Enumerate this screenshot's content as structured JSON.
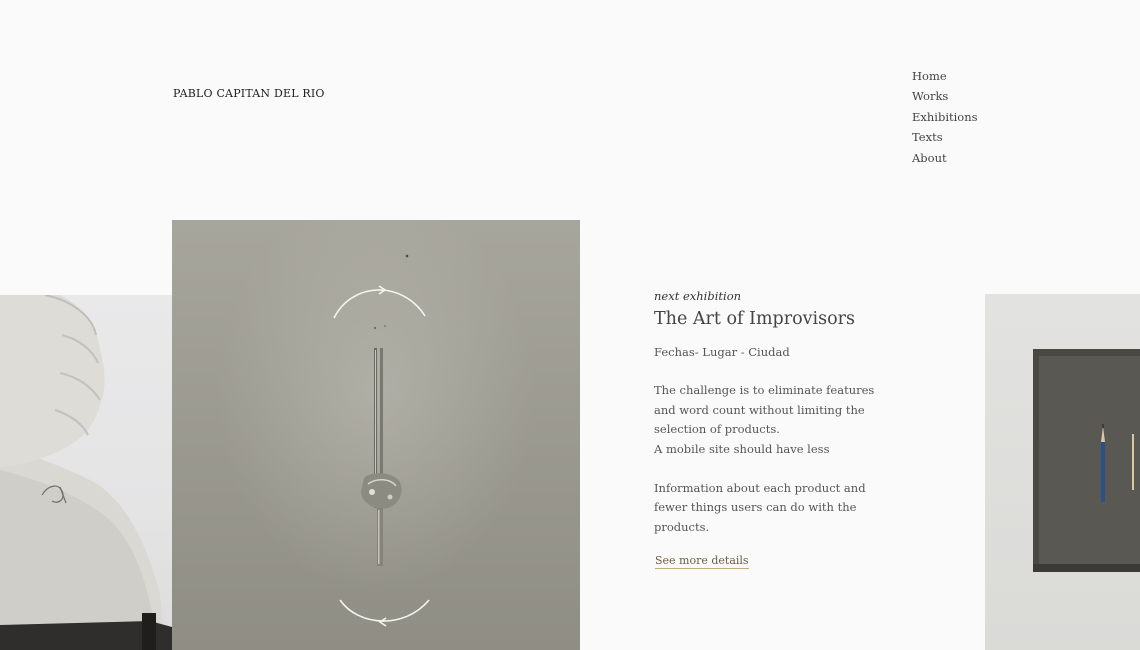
{
  "brand": "PABLO CAPITAN DEL RIO",
  "nav": {
    "items": [
      {
        "label": "Home"
      },
      {
        "label": "Works"
      },
      {
        "label": "Exhibitions"
      },
      {
        "label": "Texts"
      },
      {
        "label": "About"
      }
    ]
  },
  "exhibition": {
    "eyebrow": "next exhibition",
    "title": "The Art of Improvisors",
    "meta": "Fechas- Lugar - Ciudad",
    "paragraphs": [
      "The challenge is to eliminate features and word count without limiting the selection of products.",
      "A mobile site should have less",
      "Information about each product and fewer things users can do with the products."
    ],
    "link_label": "See more details"
  },
  "colors": {
    "background": "#fafafa",
    "text": "#4a4a4a",
    "link_underline": "#c3a97f"
  }
}
